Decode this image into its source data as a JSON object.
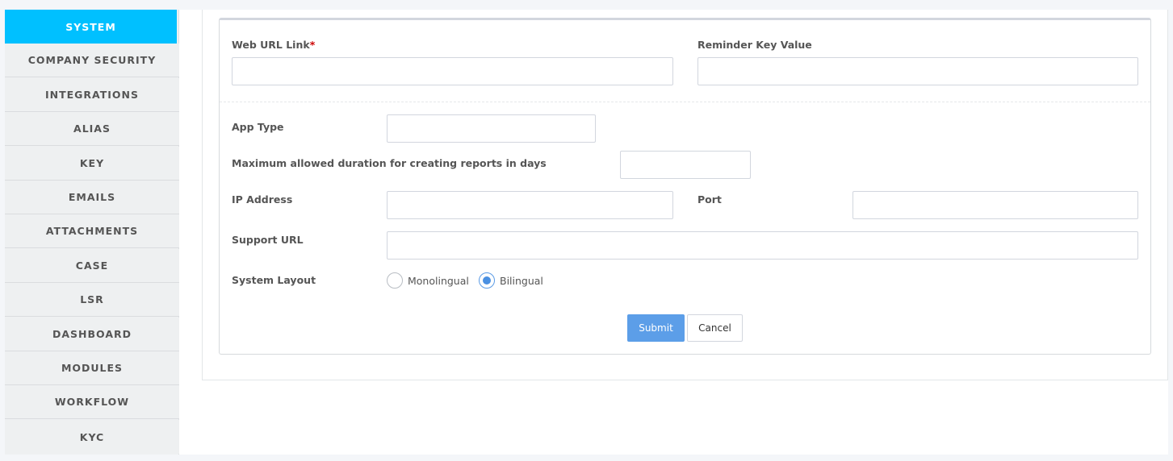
{
  "sidebar": {
    "items": [
      {
        "label": "SYSTEM",
        "active": true
      },
      {
        "label": "COMPANY SECURITY"
      },
      {
        "label": "INTEGRATIONS"
      },
      {
        "label": "ALIAS"
      },
      {
        "label": "KEY"
      },
      {
        "label": "EMAILS"
      },
      {
        "label": "ATTACHMENTS"
      },
      {
        "label": "CASE"
      },
      {
        "label": "LSR"
      },
      {
        "label": "DASHBOARD"
      },
      {
        "label": "MODULES"
      },
      {
        "label": "WORKFLOW"
      },
      {
        "label": "KYC"
      }
    ]
  },
  "form": {
    "web_url": {
      "label": "Web URL Link",
      "required_mark": "*",
      "value": ""
    },
    "reminder_key": {
      "label": "Reminder Key Value",
      "value": ""
    },
    "app_type": {
      "label": "App Type",
      "value": ""
    },
    "max_duration": {
      "label": "Maximum allowed duration for creating reports in days",
      "value": ""
    },
    "ip_address": {
      "label": "IP Address",
      "value": ""
    },
    "port": {
      "label": "Port",
      "value": ""
    },
    "support_url": {
      "label": "Support URL",
      "value": ""
    },
    "system_layout": {
      "label": "System Layout",
      "options": [
        "Monolingual",
        "Bilingual"
      ],
      "selected": "Bilingual"
    },
    "submit_label": "Submit",
    "cancel_label": "Cancel"
  },
  "colors": {
    "active_nav": "#00c0ff",
    "primary_button": "#5c9ee8",
    "required": "#cc0000"
  }
}
